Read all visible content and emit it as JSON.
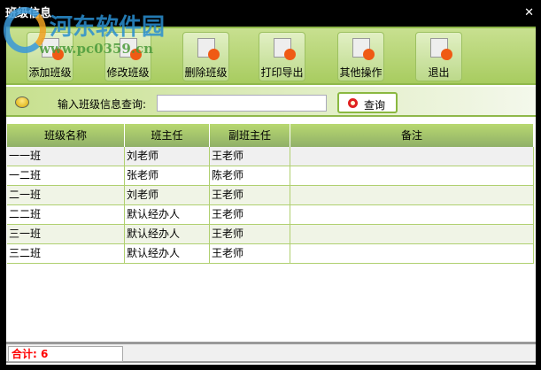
{
  "window": {
    "title": "班级信息",
    "close": "✕"
  },
  "watermark": {
    "name": "河东软件园",
    "url": "www.pc0359.cn"
  },
  "toolbar": [
    {
      "label": "添加班级",
      "icon": "add-icon"
    },
    {
      "label": "修改班级",
      "icon": "edit-icon"
    },
    {
      "label": "删除班级",
      "icon": "delete-icon"
    },
    {
      "label": "打印导出",
      "icon": "print-export-icon"
    },
    {
      "label": "其他操作",
      "icon": "other-icon"
    },
    {
      "label": "退出",
      "icon": "exit-icon"
    }
  ],
  "search": {
    "label": "输入班级信息查询:",
    "value": "",
    "button": "查询"
  },
  "table": {
    "headers": [
      "班级名称",
      "班主任",
      "副班主任",
      "备注"
    ],
    "rows": [
      [
        "一一班",
        "刘老师",
        "王老师",
        ""
      ],
      [
        "一二班",
        "张老师",
        "陈老师",
        ""
      ],
      [
        "二一班",
        "刘老师",
        "王老师",
        ""
      ],
      [
        "二二班",
        "默认经办人",
        "王老师",
        ""
      ],
      [
        "三一班",
        "默认经办人",
        "王老师",
        ""
      ],
      [
        "三二班",
        "默认经办人",
        "王老师",
        ""
      ]
    ]
  },
  "status": {
    "total": "合计: 6"
  }
}
